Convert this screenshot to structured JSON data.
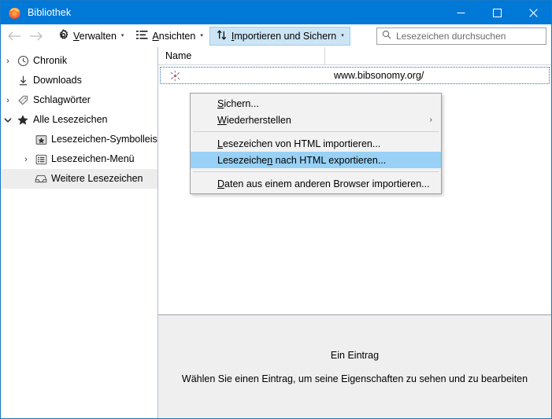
{
  "window": {
    "title": "Bibliothek",
    "app_icon": "firefox-logo-icon",
    "titlebar_color": "#0078d7",
    "controls": {
      "minimize": "—",
      "maximize": "☐",
      "close": "✕"
    }
  },
  "toolbar": {
    "back_icon": "←",
    "forward_icon": "→",
    "manage": {
      "label": "Verwalten",
      "accesskey": "V",
      "icon": "gear-icon",
      "caret": "▾"
    },
    "views": {
      "label": "Ansichten",
      "accesskey": "A",
      "icon": "list-view-icon",
      "caret": "▾"
    },
    "import_backup": {
      "label": "Importieren und Sichern",
      "accesskey": "I",
      "icon": "import-export-arrows-icon",
      "caret": "▾",
      "active": true,
      "active_bg": "#cce5f5"
    }
  },
  "search": {
    "placeholder": "Lesezeichen durchsuchen",
    "value": "",
    "icon": "search-icon"
  },
  "sidebar": {
    "items": [
      {
        "label": "Chronik",
        "icon": "clock-icon",
        "twisty": "›",
        "expanded": false,
        "indent": 0,
        "selected": false
      },
      {
        "label": "Downloads",
        "icon": "download-arrow-icon",
        "twisty": "",
        "expanded": false,
        "indent": 0,
        "selected": false
      },
      {
        "label": "Schlagwörter",
        "icon": "tag-icon",
        "twisty": "›",
        "expanded": false,
        "indent": 0,
        "selected": false
      },
      {
        "label": "Alle Lesezeichen",
        "icon": "star-icon",
        "twisty": "⌄",
        "expanded": true,
        "indent": 0,
        "selected": false
      },
      {
        "label": "Lesezeichen-Symbolleiste",
        "icon": "toolbar-star-icon",
        "twisty": "",
        "expanded": false,
        "indent": 1,
        "selected": false
      },
      {
        "label": "Lesezeichen-Menü",
        "icon": "menu-list-icon",
        "twisty": "›",
        "expanded": false,
        "indent": 1,
        "selected": false
      },
      {
        "label": "Weitere Lesezeichen",
        "icon": "inbox-tray-icon",
        "twisty": "",
        "expanded": false,
        "indent": 1,
        "selected": true
      }
    ]
  },
  "list": {
    "columns": [
      "Name"
    ],
    "rows": [
      {
        "icon": "broken-link-icon",
        "name": "",
        "url": "www.bibsonomy.org/"
      }
    ]
  },
  "detail": {
    "title": "Ein Eintrag",
    "subtitle": "Wählen Sie einen Eintrag, um seine Eigenschaften zu sehen und zu bearbeiten"
  },
  "menu": {
    "items": [
      {
        "label": "Sichern...",
        "accesskey": "S",
        "type": "item",
        "highlight": false,
        "submenu": false
      },
      {
        "label": "Wiederherstellen",
        "accesskey": "W",
        "type": "item",
        "highlight": false,
        "submenu": true,
        "submenu_arrow": "›"
      },
      {
        "type": "separator"
      },
      {
        "label": "Lesezeichen von HTML importieren...",
        "accesskey": "L",
        "type": "item",
        "highlight": false,
        "submenu": false
      },
      {
        "label": "Lesezeichen nach HTML exportieren...",
        "accesskey": "n",
        "type": "item",
        "highlight": true,
        "submenu": false
      },
      {
        "type": "separator"
      },
      {
        "label": "Daten aus einem anderen Browser importieren...",
        "accesskey": "D",
        "type": "item",
        "highlight": false,
        "submenu": false
      }
    ],
    "highlight_color": "#98d1f5"
  }
}
